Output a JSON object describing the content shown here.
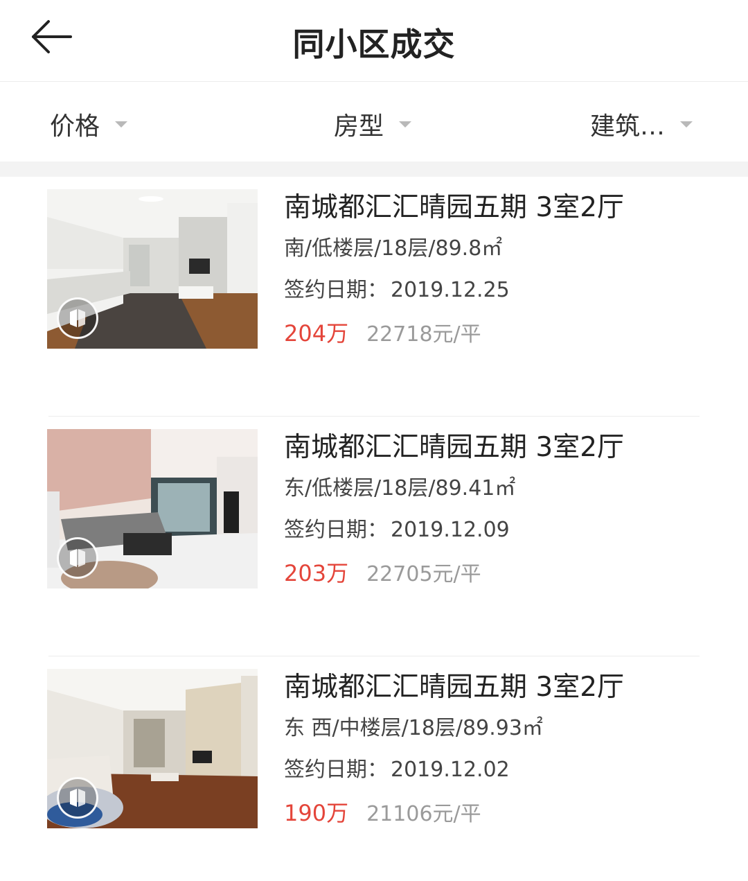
{
  "header": {
    "title": "同小区成交"
  },
  "filters": [
    {
      "label": "价格"
    },
    {
      "label": "房型"
    },
    {
      "label": "建筑…"
    }
  ],
  "listings": [
    {
      "title": "南城都汇汇晴园五期 3室2厅",
      "spec": "南/低楼层/18层/89.8㎡",
      "date_label": "签约日期：",
      "date": "2019.12.25",
      "price": "204万",
      "unit_price": "22718元/平"
    },
    {
      "title": "南城都汇汇晴园五期 3室2厅",
      "spec": "东/低楼层/18层/89.41㎡",
      "date_label": "签约日期：",
      "date": "2019.12.09",
      "price": "203万",
      "unit_price": "22705元/平"
    },
    {
      "title": "南城都汇汇晴园五期 3室2厅",
      "spec": "东 西/中楼层/18层/89.93㎡",
      "date_label": "签约日期：",
      "date": "2019.12.02",
      "price": "190万",
      "unit_price": "21106元/平"
    }
  ],
  "icons": {
    "back": "back-arrow-icon",
    "filter_caret": "caret-down-icon",
    "vr": "vr-tour-icon"
  },
  "colors": {
    "price": "#e4453a",
    "unit_price": "#9a9a9a",
    "caret": "#b9b9b9"
  }
}
